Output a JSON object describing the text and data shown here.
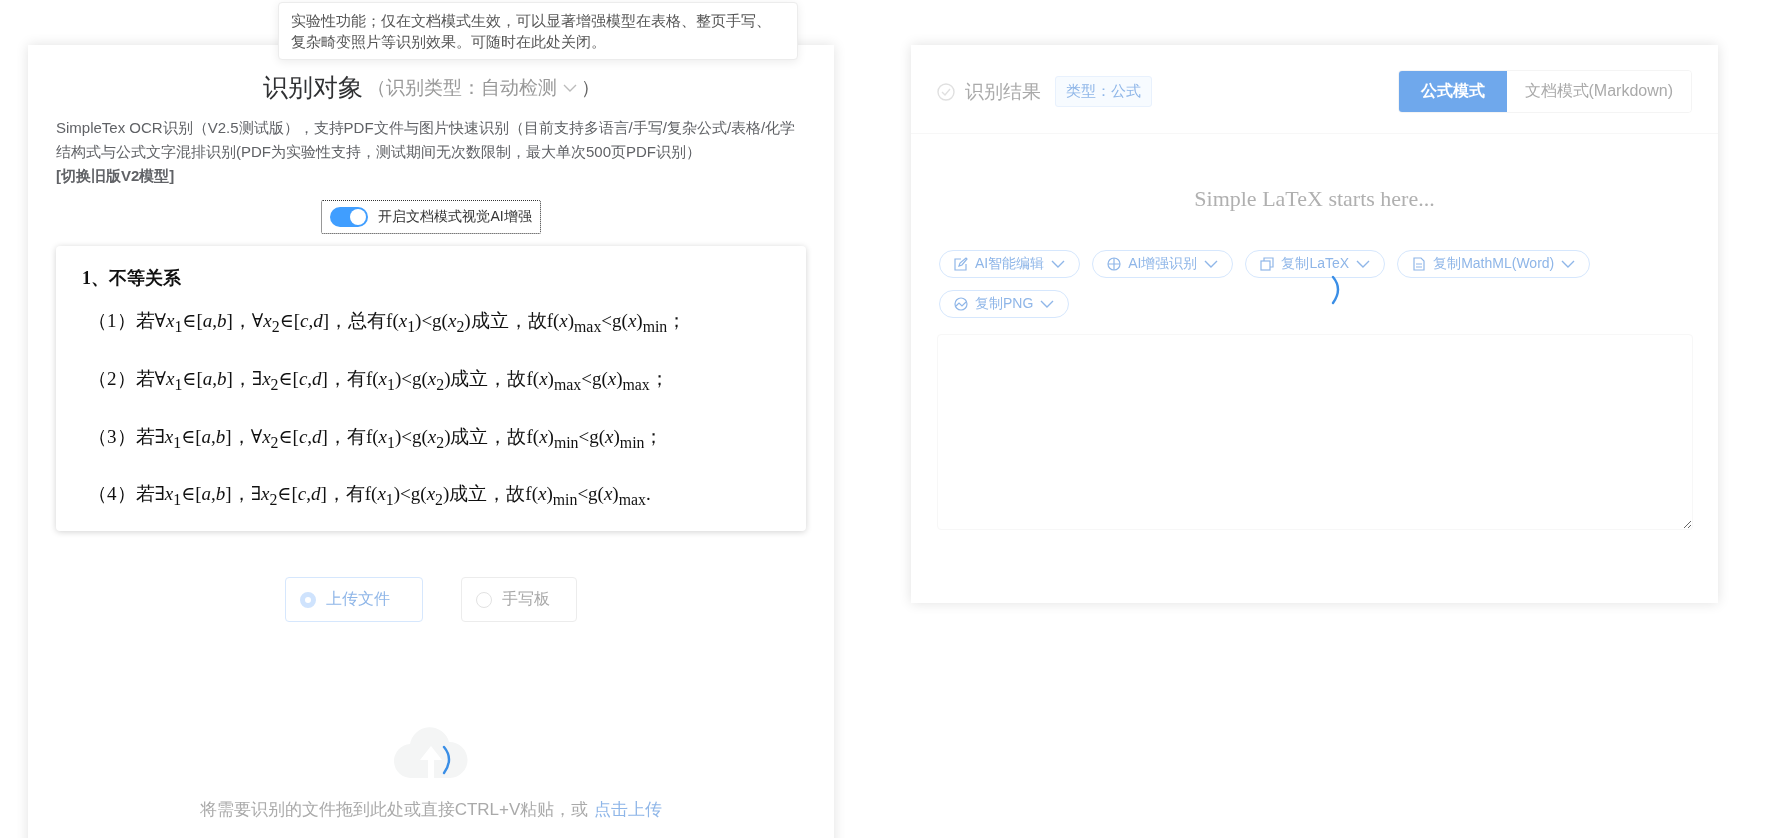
{
  "left_panel": {
    "title": "识别对象",
    "type_select": {
      "label": "（识别类型：自动检测",
      "suffix": "）"
    },
    "description": "SimpleTex OCR识别（V2.5测试版），支持PDF文件与图片快速识别（目前支持多语言/手写/复杂公式/表格/化学结构式与公式文字混排识别(PDF为实验性支持，测试期间无次数限制，最大单次500页PDF识别）",
    "legacy_link": "[切换旧版V2模型]",
    "tooltip": "实验性功能；仅在文档模式生效，可以显著增强模型在表格、整页手写、复杂畸变照片等识别效果。可随时在此处关闭。",
    "ai_toggle": {
      "label": "开启文档模式视觉AI增强",
      "on": true
    },
    "document": {
      "heading": "1、不等关系",
      "lines": [
        "（1）若∀*x*$_{1}$∈[*a*,*b*]，∀*x*$_{2}$∈[*c*,*d*]，总有f(*x*$_{1}$)<g(*x*$_{2}$)成立，故f(*x*)$_{max}$<g(*x*)$_{min}$；",
        "（2）若∀*x*$_{1}$∈[*a*,*b*]，∃*x*$_{2}$∈[*c*,*d*]，有f(*x*$_{1}$)<g(*x*$_{2}$)成立，故f(*x*)$_{max}$<g(*x*)$_{max}$；",
        "（3）若∃*x*$_{1}$∈[*a*,*b*]，∀*x*$_{2}$∈[*c*,*d*]，有f(*x*$_{1}$)<g(*x*$_{2}$)成立，故f(*x*)$_{min}$<g(*x*)$_{min}$；",
        "（4）若∃*x*$_{1}$∈[*a*,*b*]，∃*x*$_{2}$∈[*c*,*d*]，有f(*x*$_{1}$)<g(*x*$_{2}$)成立，故f(*x*)$_{min}$<g(*x*)$_{max}$."
      ]
    },
    "input_modes": [
      {
        "label": "上传文件",
        "selected": true
      },
      {
        "label": "手写板",
        "selected": false
      }
    ],
    "drop_hint": "将需要识别的文件拖到此处或直接CTRL+V粘贴，或",
    "upload_link": "点击上传"
  },
  "right_panel": {
    "title": "识别结果",
    "type_tag": "类型：公式",
    "modes": [
      {
        "label": "公式模式",
        "selected": true
      },
      {
        "label": "文档模式(Markdown)",
        "selected": false
      }
    ],
    "placeholder": "Simple LaTeX starts here...",
    "actions": [
      {
        "label": "AI智能编辑",
        "kind": "edit"
      },
      {
        "label": "AI增强识别",
        "kind": "target"
      },
      {
        "label": "复制LaTeX",
        "kind": "copy"
      },
      {
        "label": "复制MathML(Word)",
        "kind": "doc"
      },
      {
        "label": "复制PNG",
        "kind": "image"
      }
    ]
  }
}
